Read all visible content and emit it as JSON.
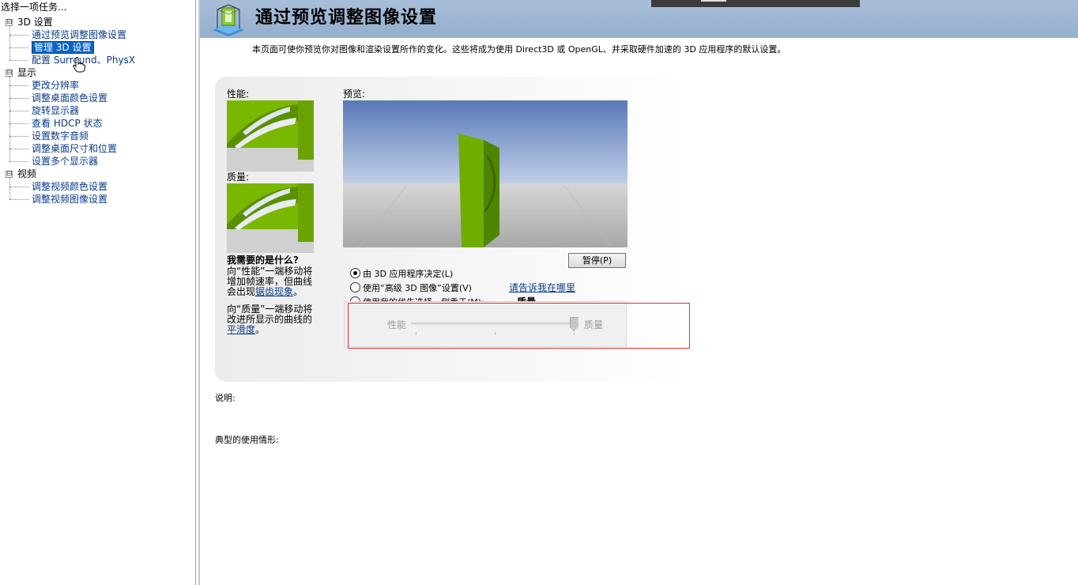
{
  "left_pane": {
    "title": "选择一项任务...",
    "groups": [
      {
        "label": "3D 设置",
        "expander": "⊟",
        "items": [
          "通过预览调整图像设置",
          "管理 3D 设置",
          "配置 Surround、PhysX"
        ]
      },
      {
        "label": "显示",
        "expander": "⊟",
        "items": [
          "更改分辨率",
          "调整桌面颜色设置",
          "旋转显示器",
          "查看 HDCP 状态",
          "设置数字音频",
          "调整桌面尺寸和位置",
          "设置多个显示器"
        ]
      },
      {
        "label": "视频",
        "expander": "⊟",
        "items": [
          "调整视频颜色设置",
          "调整视频图像设置"
        ]
      }
    ],
    "selected_item": "管理 3D 设置"
  },
  "header": {
    "title": "通过预览调整图像设置"
  },
  "intro": "本页面可使你预览你对图像和渲染设置所作的变化。这些将成为使用 Direct3D 或 OpenGL、并采取硬件加速的 3D 应用程序的默认设置。",
  "panel": {
    "performance_label": "性能:",
    "quality_label": "质量:",
    "preview_label": "预览:",
    "help_title": "我需要的是什么?",
    "help_perf_pre": "向“性能”一端移动将增加帧速率，但曲线会出现",
    "help_perf_link": "锯齿现象",
    "help_perf_post": "。",
    "help_qual_pre": "向“质量”一端移动将改进所显示的曲线的",
    "help_qual_link": "平滑度",
    "help_qual_post": "。",
    "pause_button": "暂停(P)",
    "radio_options": [
      {
        "label": "由 3D 应用程序决定(L)",
        "checked": true
      },
      {
        "label": "使用“高级 3D 图像”设置(V)",
        "checked": false
      },
      {
        "label": "使用我的优先选择，侧重于(M):",
        "checked": false
      }
    ],
    "where_link": "请告诉我在哪里",
    "slider": {
      "min_label": "性能",
      "max_label": "质量",
      "value_label": "质量",
      "value_fraction": 1.0
    }
  },
  "description_label": "说明:",
  "usage_label": "典型的使用情形:",
  "colors": {
    "banner": "#a9bfd9",
    "link": "#0a3a8a",
    "selection": "#0a64c8",
    "highlight_box": "#e53030",
    "nvidia_green": "#76b900"
  }
}
